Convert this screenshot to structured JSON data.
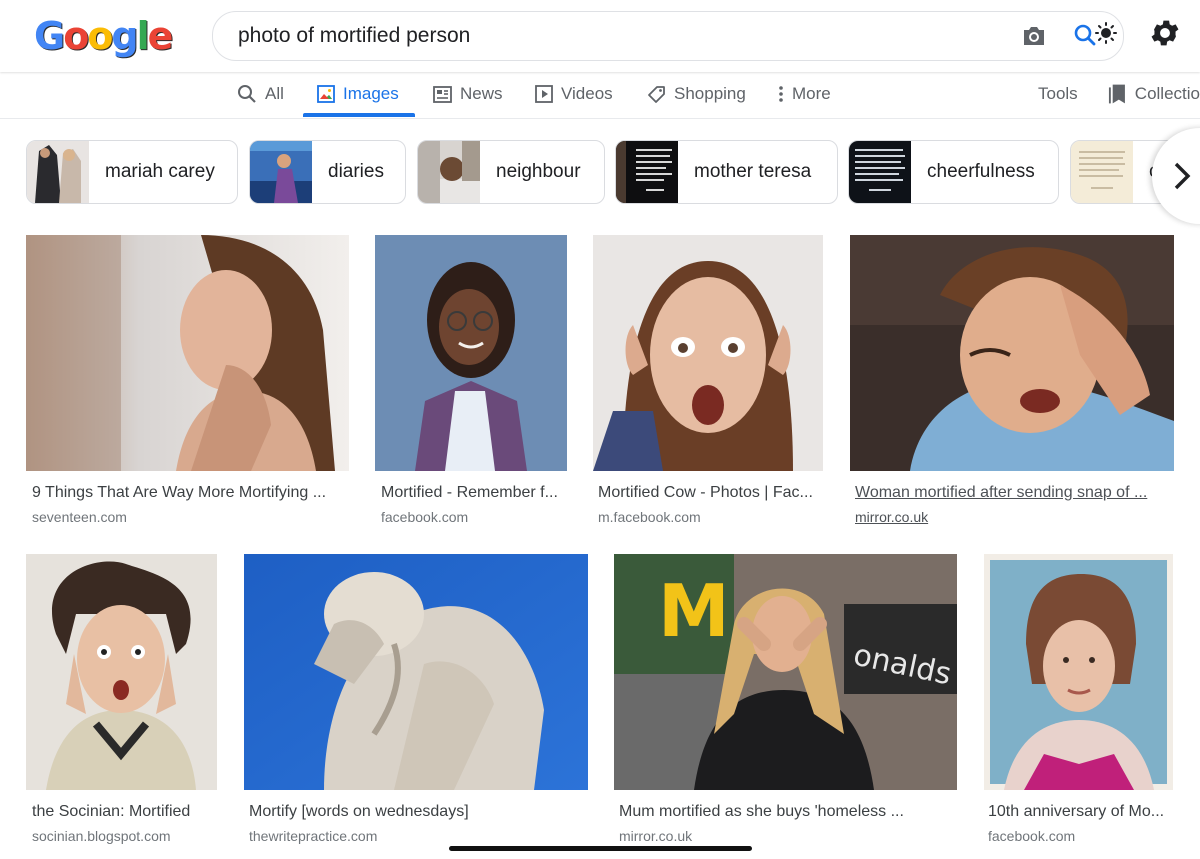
{
  "logo": {
    "text": "Google"
  },
  "search": {
    "query": "photo of mortified person"
  },
  "tabs": [
    {
      "label": "All",
      "icon": "search-icon"
    },
    {
      "label": "Images",
      "icon": "images-icon",
      "active": true
    },
    {
      "label": "News",
      "icon": "news-icon"
    },
    {
      "label": "Videos",
      "icon": "videos-icon"
    },
    {
      "label": "Shopping",
      "icon": "tag-icon"
    },
    {
      "label": "More",
      "icon": "more-vert-icon"
    }
  ],
  "tools": {
    "label": "Tools"
  },
  "collections": {
    "label": "Collectio",
    "icon": "bookmark-icon"
  },
  "chips": [
    {
      "label": "mariah carey"
    },
    {
      "label": "diaries"
    },
    {
      "label": "neighbour"
    },
    {
      "label": "mother teresa"
    },
    {
      "label": "cheerfulness"
    },
    {
      "label": "c"
    }
  ],
  "results": [
    {
      "title": "9 Things That Are Way More Mortifying ...",
      "source": "seventeen.com"
    },
    {
      "title": "Mortified - Remember f...",
      "source": "facebook.com"
    },
    {
      "title": "Mortified Cow - Photos | Fac...",
      "source": "m.facebook.com"
    },
    {
      "title": "Woman mortified after sending snap of ...",
      "source": "mirror.co.uk",
      "visited": true
    },
    {
      "title": "the Socinian: Mortified",
      "source": "socinian.blogspot.com"
    },
    {
      "title": "Mortify [words on wednesdays]",
      "source": "thewritepractice.com"
    },
    {
      "title": "Mum mortified as she buys 'homeless ...",
      "source": "mirror.co.uk"
    },
    {
      "title": "10th anniversary of Mo...",
      "source": "facebook.com"
    }
  ],
  "image_texts": {
    "mcd_sign": "M",
    "store_sign": "onalds"
  },
  "colors": {
    "accent": "#1a73e8",
    "text": "#202124",
    "muted": "#70757a"
  }
}
